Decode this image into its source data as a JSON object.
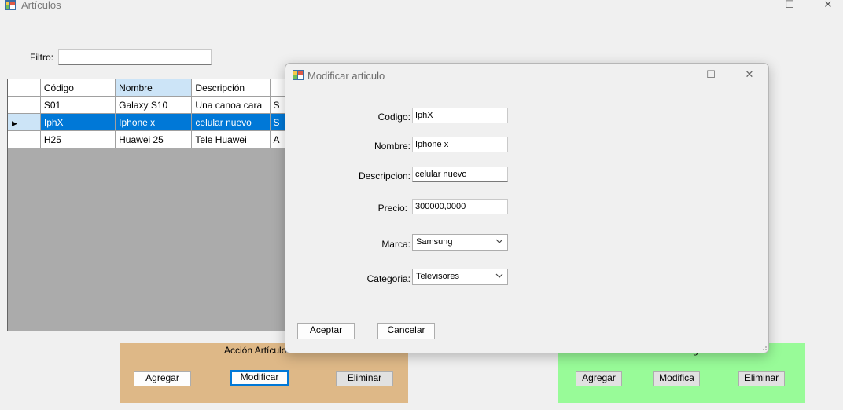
{
  "window": {
    "title": "Artículos",
    "minimize": "—",
    "maximize": "☐",
    "close": "✕"
  },
  "filter": {
    "label": "Filtro:",
    "value": ""
  },
  "grid": {
    "columns": [
      "Código",
      "Nombre",
      "Descripción",
      ""
    ],
    "rows": [
      {
        "codigo": "S01",
        "nombre": "Galaxy S10",
        "descripcion": "Una canoa cara",
        "extra": "S"
      },
      {
        "codigo": "IphX",
        "nombre": "Iphone x",
        "descripcion": "celular nuevo",
        "extra": "S"
      },
      {
        "codigo": "H25",
        "nombre": "Huawei 25",
        "descripcion": "Tele Huawei",
        "extra": "A"
      }
    ],
    "selected_row_marker": "▶"
  },
  "panel_left": {
    "title": "Acción Artículo",
    "add": "Agregar",
    "modify": "Modificar",
    "delete": "Eliminar",
    "color": "#deb887"
  },
  "panel_right": {
    "title": "g",
    "add": "Agregar",
    "modify": "Modifica",
    "delete": "Eliminar",
    "color": "#98fb98"
  },
  "dialog": {
    "title": "Modificar articulo",
    "minimize": "—",
    "maximize": "☐",
    "close": "✕",
    "fields": {
      "codigo_label": "Codigo:",
      "codigo_value": "IphX",
      "nombre_label": "Nombre:",
      "nombre_value": "Iphone x",
      "descripcion_label": "Descripcion:",
      "descripcion_value": "celular nuevo",
      "precio_label": "Precio:",
      "precio_value": "300000,0000",
      "marca_label": "Marca:",
      "marca_value": "Samsung",
      "categoria_label": "Categoria:",
      "categoria_value": "Televisores"
    },
    "accept": "Aceptar",
    "cancel": "Cancelar"
  },
  "colors": {
    "selection": "#0078d7",
    "selected_header": "#cce4f7"
  }
}
